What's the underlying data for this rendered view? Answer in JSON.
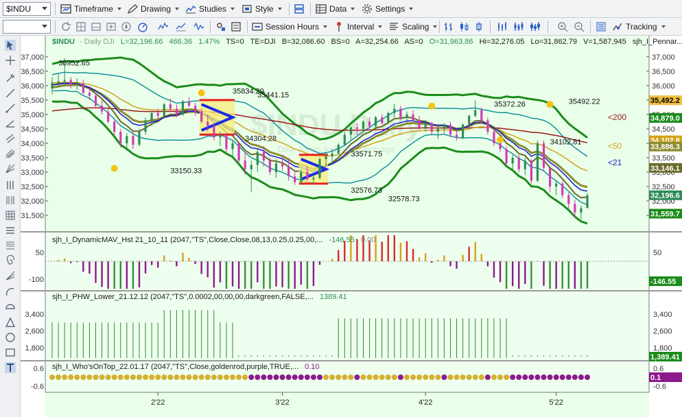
{
  "toolbar": {
    "symbol": "$INDU",
    "timeframe": "Timeframe",
    "drawing": "Drawing",
    "studies": "Studies",
    "style": "Style",
    "data": "Data",
    "settings": "Settings",
    "session_hours": "Session Hours",
    "interval": "Interval",
    "scaling": "Scaling",
    "tracking": "Tracking",
    "second_combo": ""
  },
  "colors": {
    "bg": "#eaffea",
    "panel_bg": "#efffef",
    "up": "#2e8b57",
    "down": "#d23ab7",
    "band_outer": "#1a8c1a",
    "band_inner": "#13939a",
    "ma21": "#1a1ad0",
    "ma50": "#d4a21a",
    "ma200": "#9a1a1a",
    "olive": "#8c8c30",
    "wm": "#d5ecd5"
  },
  "header": {
    "symbol": "$INDU",
    "desc": "- Daily  DJI",
    "last": "L=32,196.66",
    "chg": "466.36",
    "pct": "1.47%",
    "ts": "TS=0",
    "te": "TE=DJI",
    "bid": "B=32,086.60",
    "bs": "BS=0",
    "ask": "A=32,254.66",
    "as": "AS=0",
    "open": "O=31,963.86",
    "hi": "Hi=32,276.05",
    "lo": "Lo=31,862.79",
    "vol": "V=1,587,945",
    "study": "sjh_I_Pennar..."
  },
  "watermark": {
    "symbol": "$INDU Daily",
    "sub": "Dow Jones Industrial Average"
  },
  "price_axis": {
    "ticks": [
      "37,000",
      "36,500",
      "36,000",
      "35,500",
      "35,000",
      "34,500",
      "34,000",
      "33,500",
      "33,000",
      "32,500",
      "32,000",
      "31,500"
    ],
    "tick_values": [
      37000,
      36500,
      36000,
      35500,
      35000,
      34500,
      34000,
      33500,
      33000,
      32500,
      32000,
      31500
    ],
    "ylim": [
      31000,
      37400
    ]
  },
  "right_badges": [
    {
      "text": "35,492.2",
      "value": 35492,
      "color": "#f0c040",
      "fg": "#000"
    },
    {
      "text": "34,879.0",
      "value": 34879,
      "color": "#1a8c1a",
      "fg": "#fff"
    },
    {
      "text": "34,102.8",
      "value": 34102,
      "color": "#d4a21a",
      "fg": "#fff"
    },
    {
      "text": "33,886.3",
      "value": 33886,
      "color": "#8c8c30",
      "fg": "#fff"
    },
    {
      "text": "33,146.1",
      "value": 33146,
      "color": "#6a6a2a",
      "fg": "#fff"
    },
    {
      "text": "32,196.6",
      "value": 32196,
      "color": "#2e8b57",
      "fg": "#fff"
    },
    {
      "text": "31,559.7",
      "value": 31559,
      "color": "#1a8c1a",
      "fg": "#fff"
    }
  ],
  "ma_labels": [
    {
      "text": "<200",
      "value": 34900,
      "color": "#9a1a1a"
    },
    {
      "text": "<50",
      "value": 33900,
      "color": "#d4a21a"
    },
    {
      "text": "<21",
      "value": 33330,
      "color": "#1a1ad0"
    }
  ],
  "price_annotations": [
    {
      "text": "36952.65",
      "bar": 1,
      "value": 36700
    },
    {
      "text": "35834.29",
      "bar": 29,
      "value": 35720
    },
    {
      "text": "35441.15",
      "bar": 33,
      "value": 35590
    },
    {
      "text": "34304.28",
      "bar": 31,
      "value": 34080
    },
    {
      "text": "33150.33",
      "bar": 19,
      "value": 32960
    },
    {
      "text": "33571.75",
      "bar": 48,
      "value": 33540
    },
    {
      "text": "32576.73",
      "bar": 48,
      "value": 32290
    },
    {
      "text": "32578.73",
      "bar": 54,
      "value": 31990
    },
    {
      "text": "35372.26",
      "bar": 71,
      "value": 35270
    },
    {
      "text": "35492.22",
      "bar": 83,
      "value": 35360
    },
    {
      "text": "34102.81",
      "bar": 80,
      "value": 33960
    }
  ],
  "swing_dots": [
    {
      "bar": 10,
      "value": 33130
    },
    {
      "bar": 24,
      "value": 35750
    },
    {
      "bar": 61,
      "value": 35290
    },
    {
      "bar": 72,
      "value": 34120
    },
    {
      "bar": 80,
      "value": 35350
    }
  ],
  "date_axis": [
    {
      "label": "2'22",
      "bar": 17
    },
    {
      "label": "3'22",
      "bar": 37
    },
    {
      "label": "4'22",
      "bar": 60
    },
    {
      "label": "5'22",
      "bar": 81
    }
  ],
  "panels": {
    "mav": {
      "title": "sjh_I_DynamicMAV_Hst 21_10_11 (2047,\"TS\",Close,Close,08,13,0.25,0.25,00,...",
      "v1": "-146.55",
      "v2": "0.00",
      "ticks": [
        "50",
        "-100"
      ],
      "tick_values": [
        50,
        -100
      ],
      "badge": "-146.55"
    },
    "phw": {
      "title": "sjh_I_PHW_Lower_21.12.12 (2047,\"TS\",0.0002,00,00,00,darkgreen,FALSE,...",
      "v1": "1389.41",
      "ticks": [
        "3,400",
        "2,600",
        "1,800"
      ],
      "tick_values": [
        3400,
        2600,
        1800
      ],
      "badge": "1,389.41"
    },
    "who": {
      "title": "sjh_I_Who'sOnTop_22.01.17 (2047,\"TS\",Close,goldenrod,purple,TRUE,...",
      "v1": "0.10",
      "ticks": [
        "0.6",
        "-0.6"
      ],
      "tick_values": [
        0.6,
        -0.6
      ],
      "badge": "0.1"
    }
  },
  "chart_data": {
    "type": "candlestick",
    "bars": 91,
    "ohlc": [
      [
        35900,
        36300,
        35700,
        36100
      ],
      [
        36100,
        36400,
        35950,
        36150
      ],
      [
        36150,
        36952,
        36000,
        36200
      ],
      [
        36200,
        36300,
        35900,
        36050
      ],
      [
        36050,
        36250,
        35850,
        36080
      ],
      [
        36080,
        36200,
        35700,
        35750
      ],
      [
        35750,
        35900,
        35500,
        35650
      ],
      [
        35650,
        35700,
        35200,
        35300
      ],
      [
        35300,
        35500,
        35000,
        35100
      ],
      [
        35100,
        35200,
        34700,
        34750
      ],
      [
        34750,
        34800,
        34250,
        34400
      ],
      [
        34400,
        34500,
        33850,
        34000
      ],
      [
        34000,
        34350,
        33750,
        34250
      ],
      [
        34250,
        34450,
        33800,
        33950
      ],
      [
        33950,
        34500,
        33900,
        34400
      ],
      [
        34400,
        34900,
        34300,
        34800
      ],
      [
        34800,
        35100,
        34600,
        35050
      ],
      [
        35050,
        35200,
        34850,
        34950
      ],
      [
        34950,
        35400,
        34900,
        35350
      ],
      [
        35350,
        35550,
        35100,
        35200
      ],
      [
        35200,
        35350,
        34900,
        35000
      ],
      [
        35000,
        35500,
        34950,
        35450
      ],
      [
        35450,
        35600,
        35250,
        35300
      ],
      [
        35300,
        35400,
        34950,
        35100
      ],
      [
        35100,
        35200,
        34700,
        34750
      ],
      [
        34750,
        35000,
        34400,
        34600
      ],
      [
        34600,
        34700,
        34100,
        34200
      ],
      [
        34200,
        34400,
        33900,
        34300
      ],
      [
        34300,
        34350,
        33700,
        33800
      ],
      [
        33800,
        34100,
        33500,
        34000
      ],
      [
        34000,
        34050,
        33300,
        33400
      ],
      [
        33400,
        33700,
        32900,
        33100
      ],
      [
        33100,
        33400,
        32300,
        33250
      ],
      [
        33250,
        33800,
        33000,
        33700
      ],
      [
        33700,
        33900,
        33200,
        33400
      ],
      [
        33400,
        33500,
        32900,
        33000
      ],
      [
        33000,
        33450,
        32800,
        33300
      ],
      [
        33300,
        33600,
        33050,
        33200
      ],
      [
        33200,
        33500,
        32700,
        32850
      ],
      [
        32850,
        33050,
        32550,
        32650
      ],
      [
        32650,
        33100,
        32600,
        33000
      ],
      [
        33000,
        33200,
        32700,
        32750
      ],
      [
        32750,
        32900,
        32576,
        32800
      ],
      [
        32800,
        33500,
        32750,
        33450
      ],
      [
        33450,
        33700,
        33200,
        33550
      ],
      [
        33550,
        33800,
        33300,
        33650
      ],
      [
        33650,
        34000,
        33600,
        33950
      ],
      [
        33950,
        34400,
        33900,
        34300
      ],
      [
        34300,
        34600,
        34100,
        34550
      ],
      [
        34550,
        34700,
        34300,
        34500
      ],
      [
        34500,
        34800,
        34400,
        34750
      ],
      [
        34750,
        34900,
        34500,
        34600
      ],
      [
        34600,
        34950,
        34550,
        34900
      ],
      [
        34900,
        35000,
        34650,
        34700
      ],
      [
        34700,
        35100,
        34650,
        35050
      ],
      [
        35050,
        35372,
        34900,
        35200
      ],
      [
        35200,
        35300,
        34800,
        34900
      ],
      [
        34900,
        35100,
        34700,
        35000
      ],
      [
        35000,
        35150,
        34750,
        34800
      ],
      [
        34800,
        34950,
        34450,
        34550
      ],
      [
        34550,
        34800,
        34400,
        34700
      ],
      [
        34700,
        34750,
        34300,
        34400
      ],
      [
        34400,
        34600,
        34150,
        34500
      ],
      [
        34500,
        34700,
        34350,
        34650
      ],
      [
        34650,
        34750,
        34200,
        34300
      ],
      [
        34300,
        34450,
        34100,
        34200
      ],
      [
        34200,
        34700,
        34150,
        34650
      ],
      [
        34650,
        35000,
        34600,
        34950
      ],
      [
        34950,
        35492,
        34900,
        35150
      ],
      [
        35150,
        35250,
        34700,
        34800
      ],
      [
        34800,
        34900,
        34300,
        34400
      ],
      [
        34400,
        34500,
        33900,
        34000
      ],
      [
        34000,
        34200,
        33700,
        33800
      ],
      [
        33800,
        33900,
        33200,
        33300
      ],
      [
        33300,
        33600,
        33100,
        33500
      ],
      [
        33500,
        33600,
        33000,
        33100
      ],
      [
        33100,
        33500,
        32900,
        33400
      ],
      [
        33400,
        33450,
        32600,
        32700
      ],
      [
        32700,
        34100,
        32650,
        34000
      ],
      [
        34000,
        34100,
        33050,
        33150
      ],
      [
        33150,
        33200,
        32300,
        32500
      ],
      [
        32500,
        32700,
        32200,
        32600
      ],
      [
        32600,
        32700,
        32100,
        32200
      ],
      [
        32200,
        32300,
        31700,
        31900
      ],
      [
        31900,
        32050,
        31450,
        31600
      ],
      [
        31600,
        31850,
        31350,
        31750
      ],
      [
        31750,
        32276,
        31862,
        32196
      ]
    ]
  }
}
